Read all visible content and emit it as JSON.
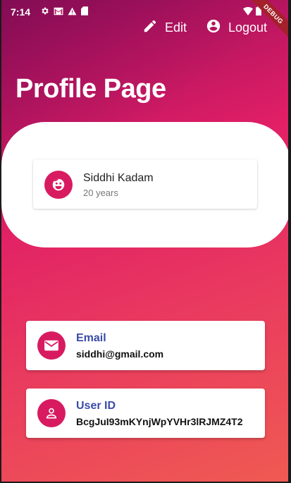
{
  "status_bar": {
    "time": "7:14",
    "left_icons": [
      "gear-icon",
      "gmail-icon",
      "alert-icon",
      "sd-card-icon"
    ],
    "right_icons": [
      "wifi-icon",
      "battery-icon"
    ]
  },
  "debug_banner": "DEBUG",
  "app_bar": {
    "edit_label": "Edit",
    "logout_label": "Logout"
  },
  "page": {
    "title": "Profile Page"
  },
  "profile": {
    "name": "Siddhi Kadam",
    "age": "20 years",
    "icon": "face-icon"
  },
  "info_cards": {
    "email": {
      "label": "Email",
      "value": "siddhi@gmail.com",
      "icon": "mail-icon"
    },
    "user_id": {
      "label": "User ID",
      "value": "BcgJuI93mKYnjWpYVHr3lRJMZ4T2",
      "icon": "person-icon"
    }
  },
  "colors": {
    "accent": "#d81b60",
    "label": "#3b4ba8",
    "gradient_top": "#8a0e57",
    "gradient_bottom": "#ef5a52"
  }
}
